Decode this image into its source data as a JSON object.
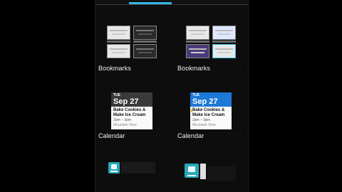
{
  "widgets": [
    {
      "label": "Bookmarks",
      "dims": "· ·"
    },
    {
      "label": "Bookmarks",
      "dims": "· ·"
    },
    {
      "label": "Calendar",
      "dims": "· ·"
    },
    {
      "label": "Calendar",
      "dims": "· ·"
    }
  ],
  "calendar": {
    "day_of_week": "TUE",
    "date": "Sep 27",
    "event_title_1": "Bake Cookies &",
    "event_title_2": "Make Ice Cream",
    "event_time": "2pm – 3pm",
    "event_location": "Mountain View"
  },
  "colors": {
    "accent": "#33b5e5",
    "calendar_header_selected": "#1e78d7",
    "calendar_header": "#3a3a3a",
    "app_icon": "#2aa7b8"
  },
  "icons": [
    "bookmark-thumbnail",
    "calendar-widget",
    "app-widget-icon"
  ]
}
